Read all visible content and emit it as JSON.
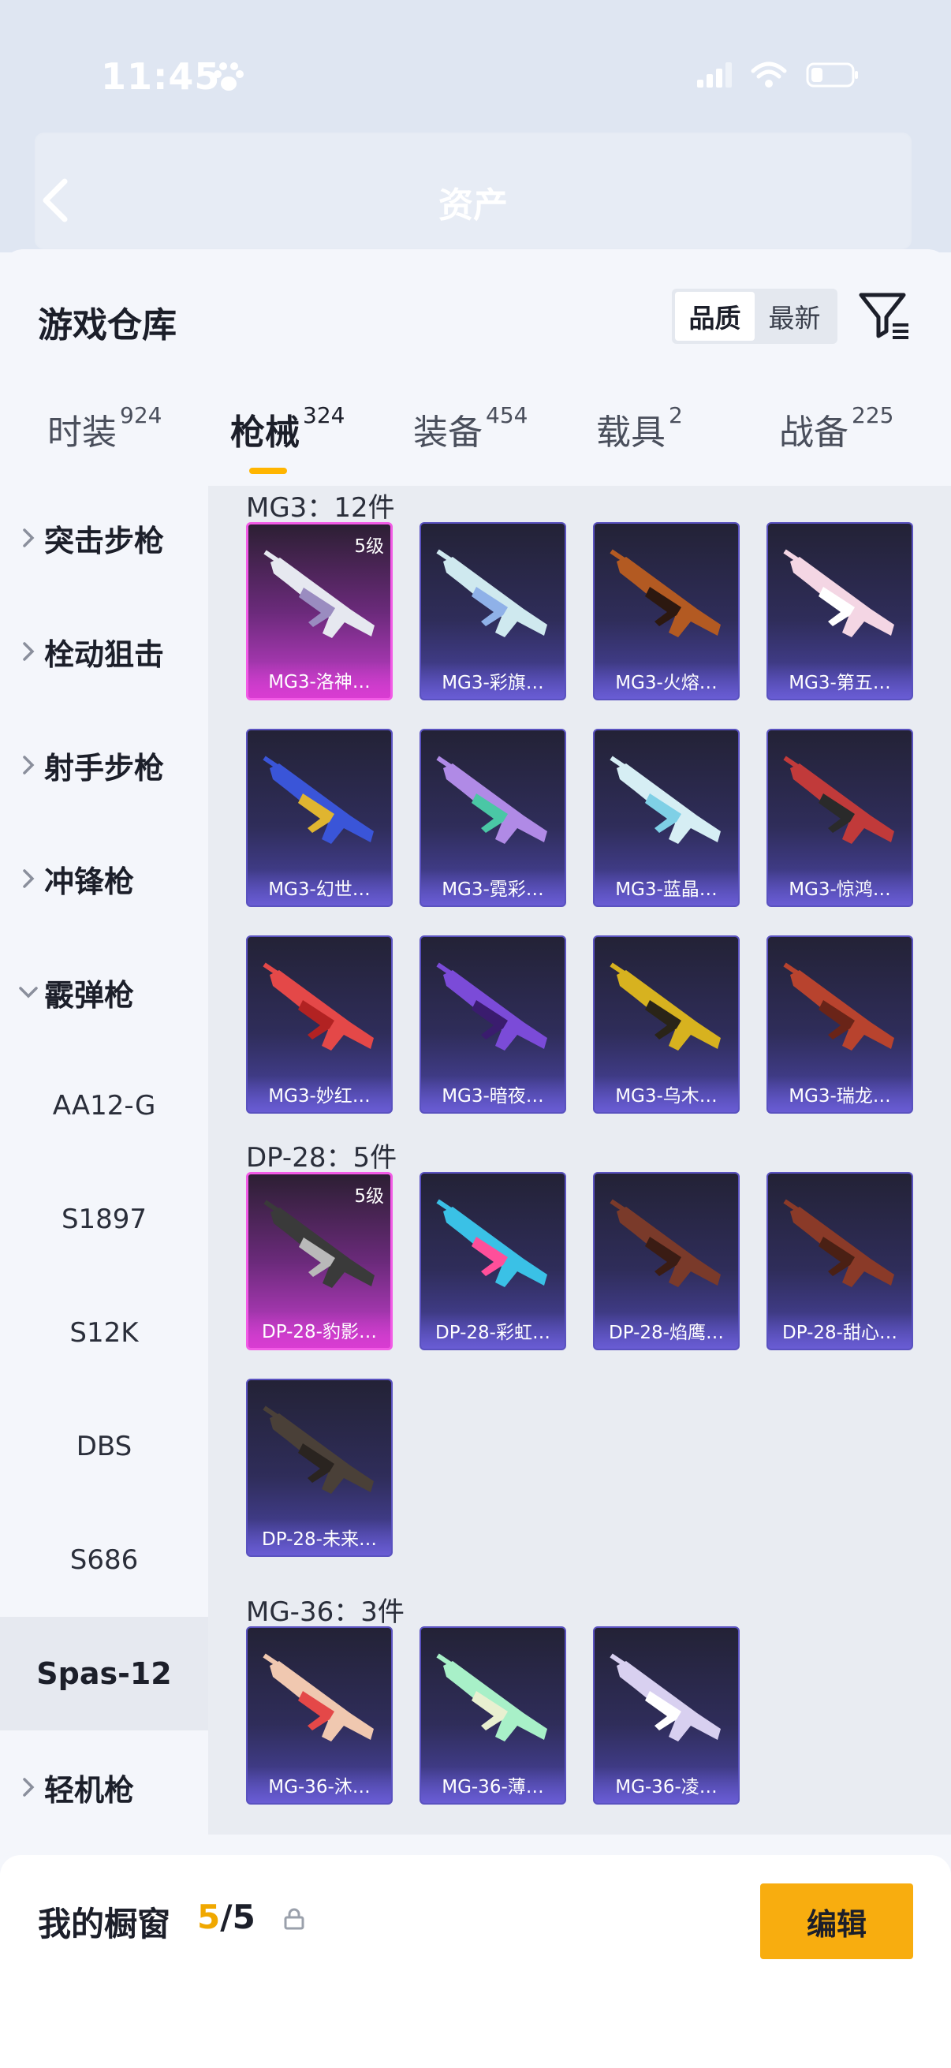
{
  "status_bar": {
    "time": "11:45"
  },
  "header": {
    "title": "资产"
  },
  "sheet": {
    "title": "游戏仓库"
  },
  "sort": {
    "options": [
      "品质",
      "最新"
    ],
    "active": "品质"
  },
  "tabs": [
    {
      "label": "时装",
      "count": "924"
    },
    {
      "label": "枪械",
      "count": "324",
      "active": true
    },
    {
      "label": "装备",
      "count": "454"
    },
    {
      "label": "载具",
      "count": "2"
    },
    {
      "label": "战备",
      "count": "225"
    }
  ],
  "sidenav": {
    "categories": [
      {
        "label": "突击步枪",
        "expanded": false
      },
      {
        "label": "栓动狙击",
        "expanded": false
      },
      {
        "label": "射手步枪",
        "expanded": false
      },
      {
        "label": "冲锋枪",
        "expanded": false
      },
      {
        "label": "霰弹枪",
        "expanded": true
      }
    ],
    "shotgun_items": [
      "AA12-G",
      "S1897",
      "S12K",
      "DBS",
      "S686",
      "Spas-12"
    ],
    "active_item": "Spas-12",
    "after": {
      "label": "轻机枪",
      "expanded": false
    }
  },
  "groups": [
    {
      "title": "MG3：12件",
      "items": [
        {
          "name": "MG3-洛神…",
          "level": "5级",
          "gold": true
        },
        {
          "name": "MG3-彩旗…"
        },
        {
          "name": "MG3-火熔…"
        },
        {
          "name": "MG3-第五…"
        },
        {
          "name": "MG3-幻世…"
        },
        {
          "name": "MG3-霓彩…"
        },
        {
          "name": "MG3-蓝晶…"
        },
        {
          "name": "MG3-惊鸿…"
        },
        {
          "name": "MG3-妙红…"
        },
        {
          "name": "MG3-暗夜…"
        },
        {
          "name": "MG3-乌木…"
        },
        {
          "name": "MG3-瑞龙…"
        }
      ]
    },
    {
      "title": "DP-28：5件",
      "items": [
        {
          "name": "DP-28-豹影…",
          "level": "5级",
          "gold": true
        },
        {
          "name": "DP-28-彩虹…"
        },
        {
          "name": "DP-28-焰鹰…"
        },
        {
          "name": "DP-28-甜心…"
        },
        {
          "name": "DP-28-未来…"
        }
      ]
    },
    {
      "title": "MG-36：3件",
      "items": [
        {
          "name": "MG-36-沐…"
        },
        {
          "name": "MG-36-薄…"
        },
        {
          "name": "MG-36-凌…"
        }
      ]
    }
  ],
  "showcase": {
    "label": "我的橱窗",
    "current": "5",
    "separator": "/",
    "total": "5"
  },
  "edit_button": {
    "label": "编辑"
  },
  "colors": {
    "accent": "#f8ad0f",
    "tab_underline": "#ffb500",
    "gold_card": "#c83fcf",
    "purple_card": "#4c46a8"
  }
}
